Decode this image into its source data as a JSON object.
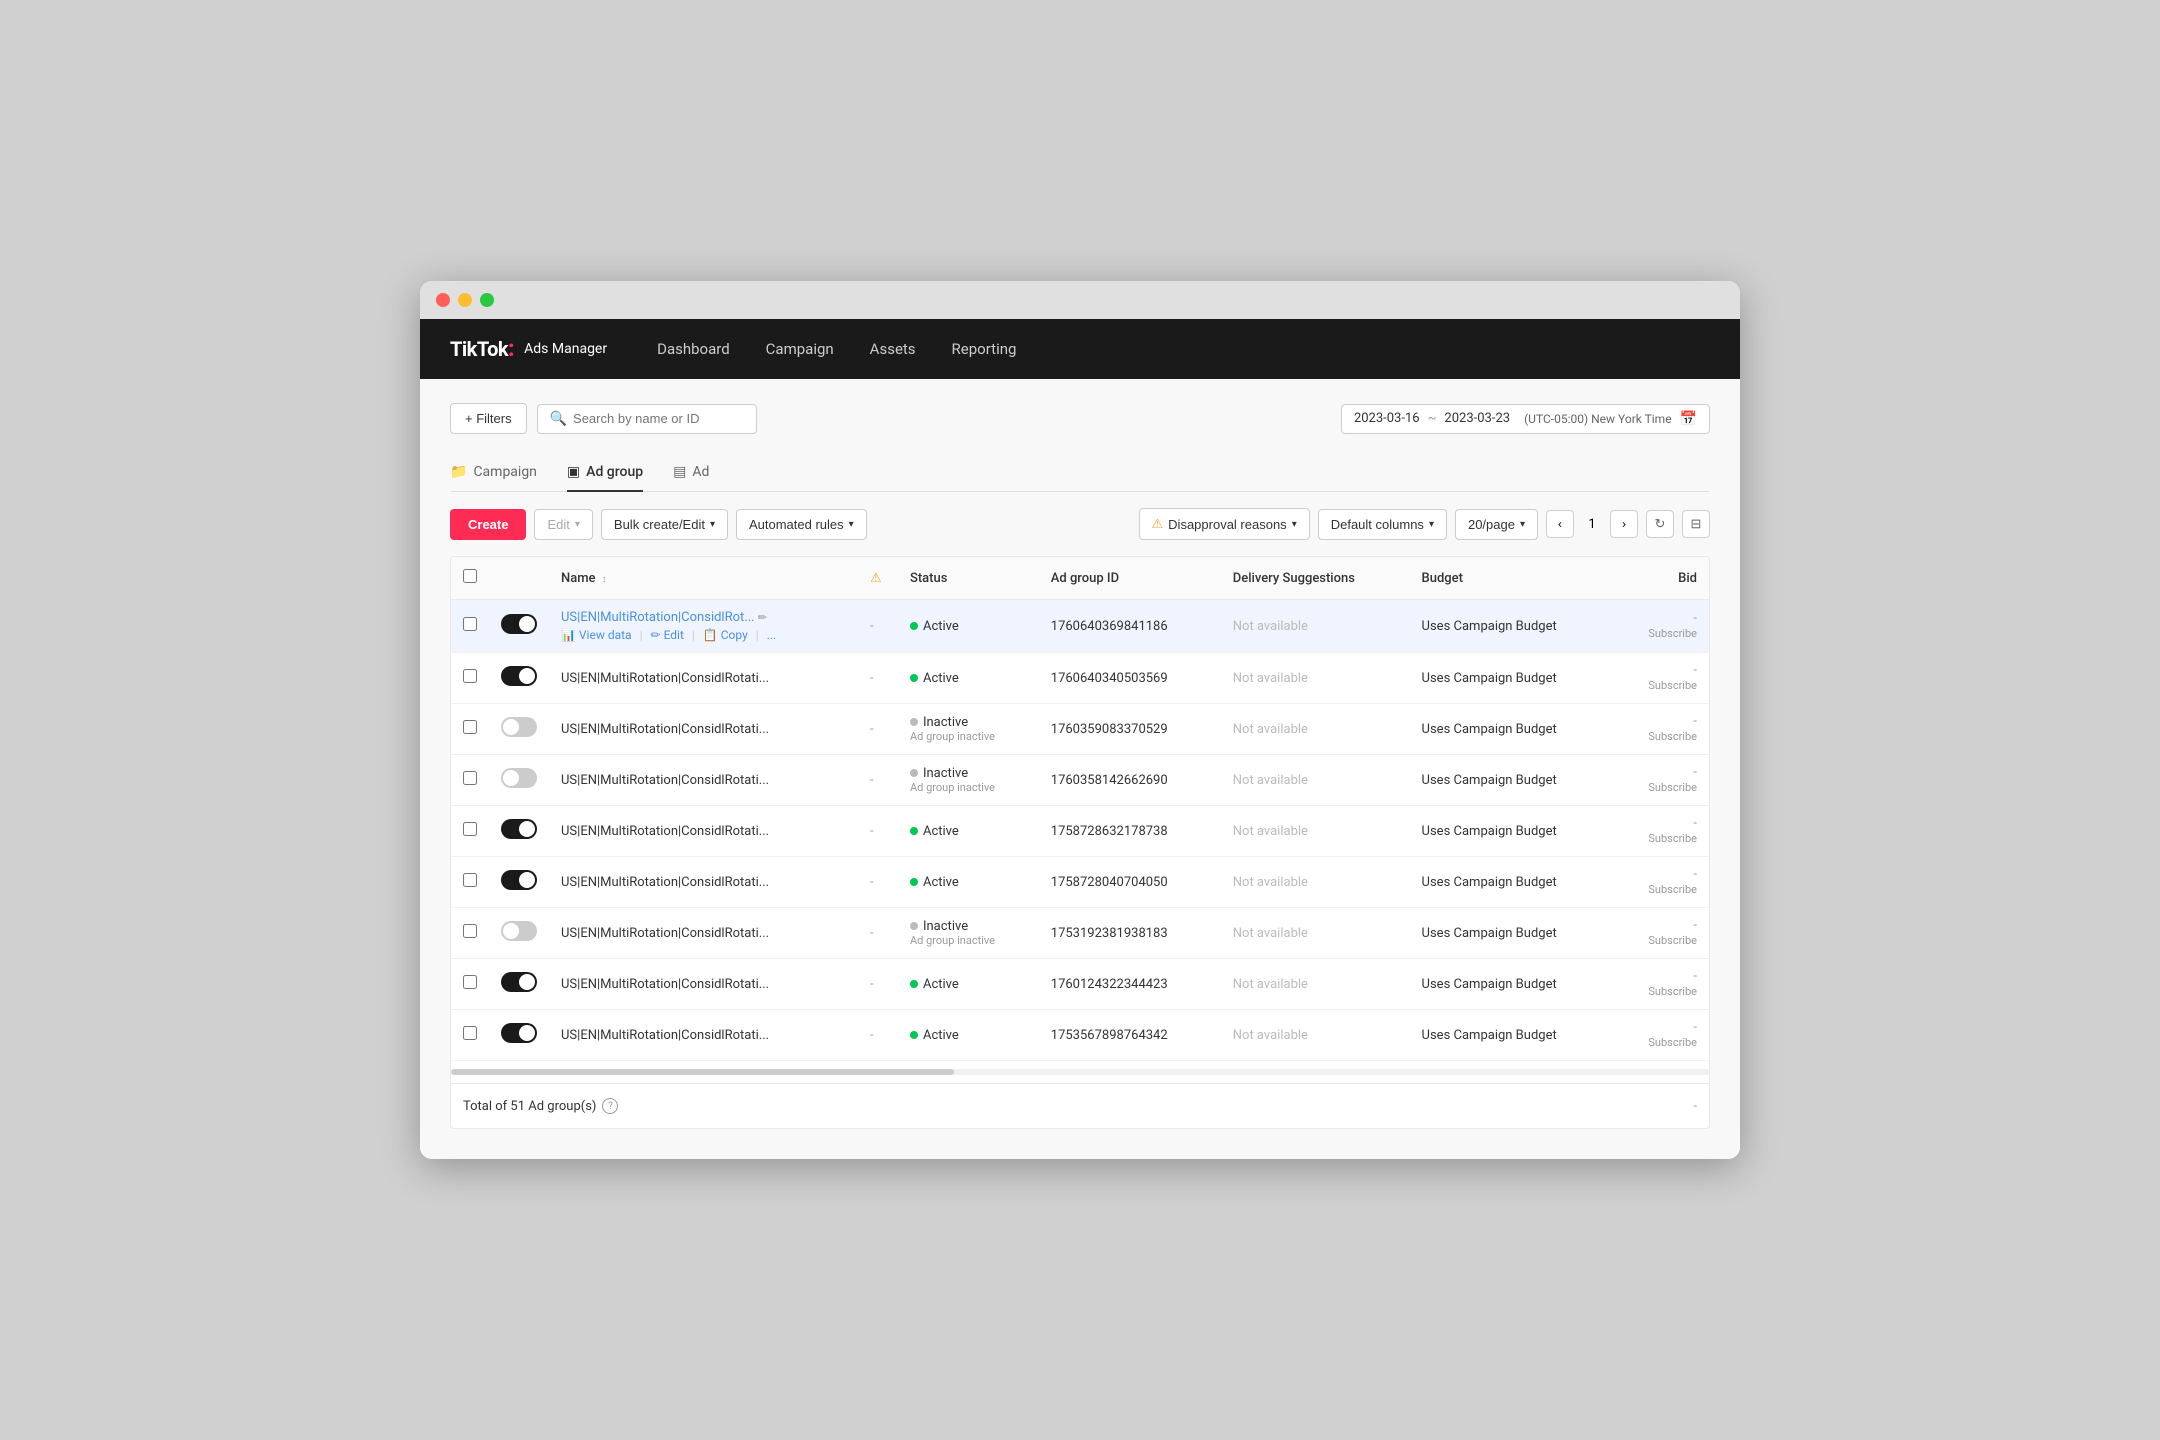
{
  "window": {
    "dots": [
      "red",
      "yellow",
      "green"
    ]
  },
  "navbar": {
    "logo": "TikTok",
    "logo_colon": ":",
    "logo_sub": "Ads Manager",
    "links": [
      "Dashboard",
      "Campaign",
      "Assets",
      "Reporting"
    ]
  },
  "toolbar": {
    "filter_label": "+ Filters",
    "search_placeholder": "Search by name or ID",
    "date_start": "2023-03-16",
    "date_tilde": "~",
    "date_end": "2023-03-23",
    "timezone": "(UTC-05:00) New York Time"
  },
  "tabs": [
    {
      "label": "Campaign",
      "icon": "📁",
      "active": false
    },
    {
      "label": "Ad group",
      "icon": "▣",
      "active": true
    },
    {
      "label": "Ad",
      "icon": "▤",
      "active": false
    }
  ],
  "actions": {
    "create": "Create",
    "edit": "Edit",
    "bulk": "Bulk create/Edit",
    "rules": "Automated rules",
    "disapproval": "Disapproval reasons",
    "columns": "Default columns",
    "per_page": "20/page",
    "page_num": "1",
    "refresh": "↻",
    "export": "⊟"
  },
  "table": {
    "headers": [
      "",
      "",
      "Name",
      "⚠",
      "Status",
      "Ad group ID",
      "Delivery Suggestions",
      "Budget",
      "Bid"
    ],
    "rows": [
      {
        "toggle": "on",
        "name": "US|EN|MultiRotation|ConsidlRot...",
        "name_link": true,
        "warning": "-",
        "status": "Active",
        "status_type": "active",
        "id": "1760640369841186",
        "delivery": "Not available",
        "budget": "Uses Campaign Budget",
        "bid": "-",
        "subscribe": "Subscribe",
        "show_actions": true,
        "highlighted": true
      },
      {
        "toggle": "on",
        "name": "US|EN|MultiRotation|ConsidlRotati...",
        "name_link": false,
        "warning": "-",
        "status": "Active",
        "status_type": "active",
        "id": "1760640340503569",
        "delivery": "Not available",
        "budget": "Uses Campaign Budget",
        "bid": "-",
        "subscribe": "Subscribe",
        "highlighted": false
      },
      {
        "toggle": "off",
        "name": "US|EN|MultiRotation|ConsidlRotati...",
        "name_link": false,
        "warning": "-",
        "status": "Inactive",
        "status_sub": "Ad group inactive",
        "status_type": "inactive",
        "id": "1760359083370529",
        "delivery": "Not available",
        "budget": "Uses Campaign Budget",
        "bid": "-",
        "subscribe": "Subscribe",
        "highlighted": false
      },
      {
        "toggle": "off",
        "name": "US|EN|MultiRotation|ConsidlRotati...",
        "name_link": false,
        "warning": "-",
        "status": "Inactive",
        "status_sub": "Ad group inactive",
        "status_type": "inactive",
        "id": "1760358142662690",
        "delivery": "Not available",
        "budget": "Uses Campaign Budget",
        "bid": "-",
        "subscribe": "Subscribe",
        "highlighted": false
      },
      {
        "toggle": "on",
        "name": "US|EN|MultiRotation|ConsidlRotati...",
        "name_link": false,
        "warning": "-",
        "status": "Active",
        "status_type": "active",
        "id": "1758728632178738",
        "delivery": "Not available",
        "budget": "Uses Campaign Budget",
        "bid": "-",
        "subscribe": "Subscribe",
        "highlighted": false
      },
      {
        "toggle": "on",
        "name": "US|EN|MultiRotation|ConsidlRotati...",
        "name_link": false,
        "warning": "-",
        "status": "Active",
        "status_type": "active",
        "id": "1758728040704050",
        "delivery": "Not available",
        "budget": "Uses Campaign Budget",
        "bid": "-",
        "subscribe": "Subscribe",
        "highlighted": false
      },
      {
        "toggle": "off",
        "name": "US|EN|MultiRotation|ConsidlRotati...",
        "name_link": false,
        "warning": "-",
        "status": "Inactive",
        "status_sub": "Ad group inactive",
        "status_type": "inactive",
        "id": "1753192381938183",
        "delivery": "Not available",
        "budget": "Uses Campaign Budget",
        "bid": "-",
        "subscribe": "Subscribe",
        "highlighted": false
      },
      {
        "toggle": "on",
        "name": "US|EN|MultiRotation|ConsidlRotati...",
        "name_link": false,
        "warning": "-",
        "status": "Active",
        "status_type": "active",
        "id": "1760124322344423",
        "delivery": "Not available",
        "budget": "Uses Campaign Budget",
        "bid": "-",
        "subscribe": "Subscribe",
        "highlighted": false
      },
      {
        "toggle": "on",
        "name": "US|EN|MultiRotation|ConsidlRotati...",
        "name_link": false,
        "warning": "-",
        "status": "Active",
        "status_type": "active",
        "id": "1753567898764342",
        "delivery": "Not available",
        "budget": "Uses Campaign Budget",
        "bid": "-",
        "subscribe": "Subscribe",
        "highlighted": false
      }
    ],
    "row_actions": [
      "View data",
      "Edit",
      "Copy",
      "..."
    ],
    "footer_total": "Total of 51 Ad group(s)"
  }
}
